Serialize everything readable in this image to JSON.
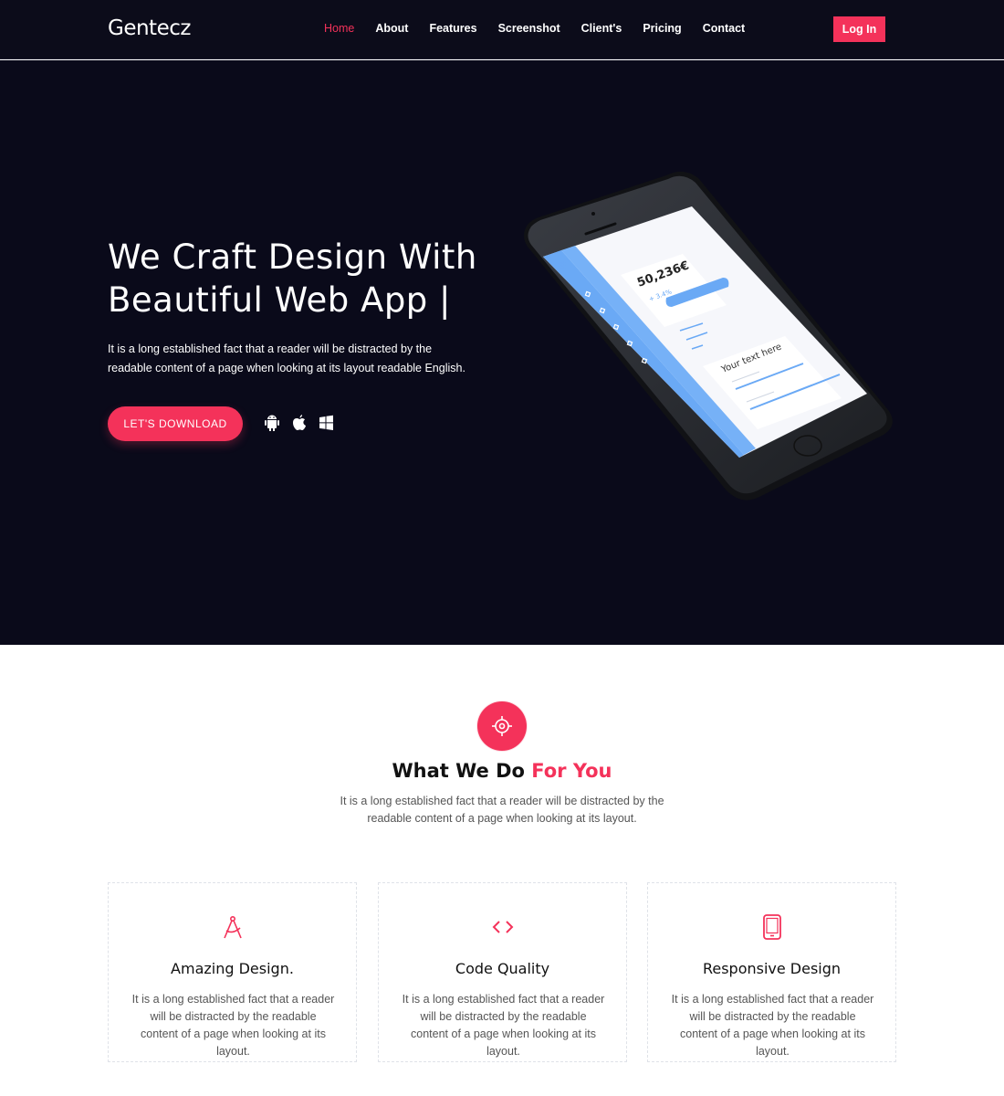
{
  "header": {
    "logo": "Gentecz",
    "nav": [
      {
        "label": "Home",
        "active": true
      },
      {
        "label": "About",
        "active": false
      },
      {
        "label": "Features",
        "active": false
      },
      {
        "label": "Screenshot",
        "active": false
      },
      {
        "label": "Client's",
        "active": false
      },
      {
        "label": "Pricing",
        "active": false
      },
      {
        "label": "Contact",
        "active": false
      }
    ],
    "login_label": "Log In"
  },
  "hero": {
    "title_line1": "We Craft Design With",
    "title_line2": "Beautiful Web App |",
    "description": "It is a long established fact that a reader will be distracted by the readable content of a page when looking at its layout readable English.",
    "download_label": "LET'S DOWNLOAD",
    "platform_icons": [
      "android-icon",
      "apple-icon",
      "windows-icon"
    ],
    "phone_screen": {
      "balance": "50,236€",
      "change": "+ 3.4%",
      "card_text": "Your text here"
    }
  },
  "services": {
    "badge_icon": "target-icon",
    "title_main": "What We Do",
    "title_accent": "For You",
    "description": "It is a long established fact that a reader will be distracted by the readable content of a page when looking at its layout.",
    "cards": [
      {
        "icon": "compass-icon",
        "title": "Amazing Design.",
        "text": "It is a long established fact that a reader will be distracted by the readable content of a page when looking at its layout."
      },
      {
        "icon": "code-icon",
        "title": "Code Quality",
        "text": "It is a long established fact that a reader will be distracted by the readable content of a page when looking at its layout."
      },
      {
        "icon": "tablet-icon",
        "title": "Responsive Design",
        "text": "It is a long established fact that a reader will be distracted by the readable content of a page when looking at its layout."
      }
    ]
  },
  "colors": {
    "accent": "#f4325a",
    "dark_bg": "#0a0a1a",
    "phone_blue": "#6aa9f5"
  }
}
